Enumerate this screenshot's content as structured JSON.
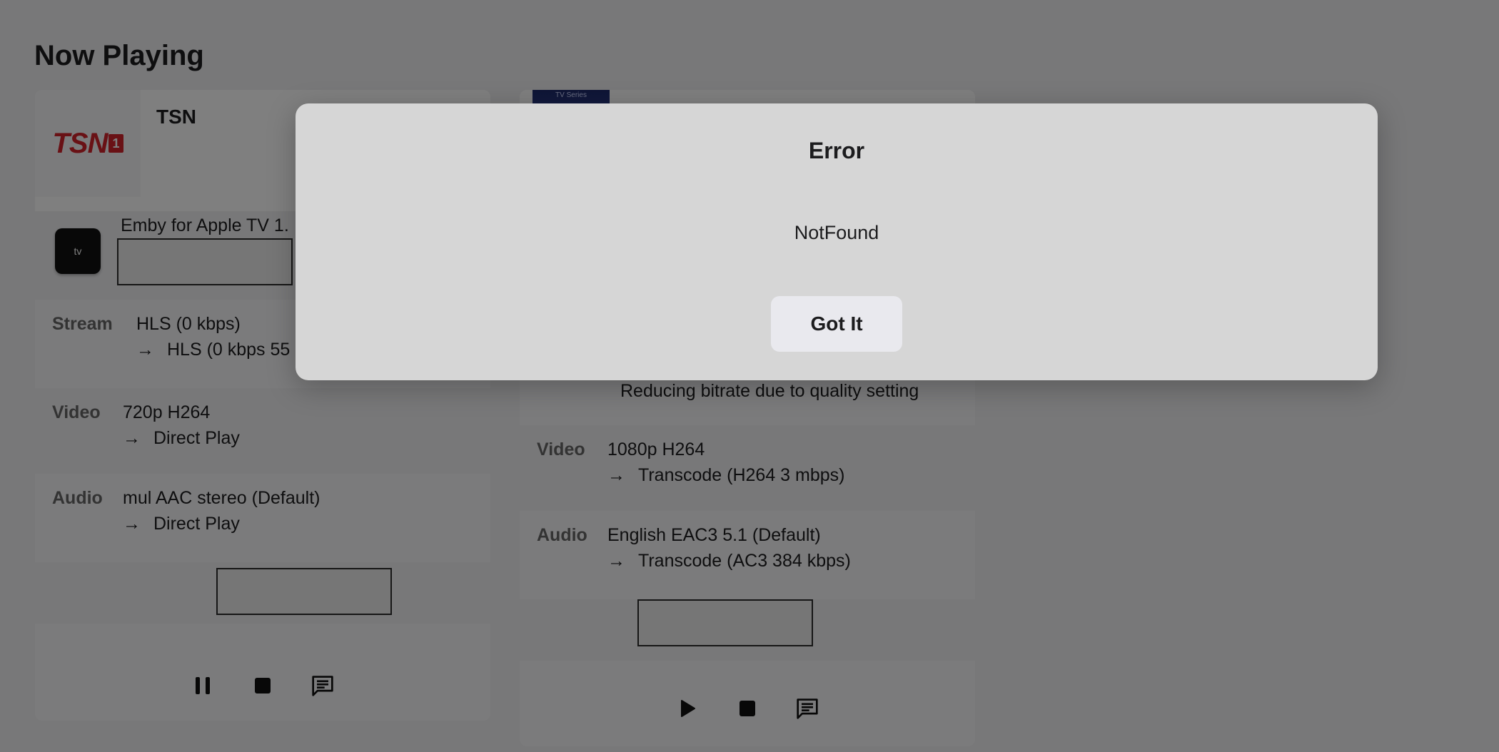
{
  "page": {
    "title": "Now Playing"
  },
  "sessions": [
    {
      "title": "TSN",
      "thumb_text": "TSN",
      "thumb_badge": "1",
      "device_icon_text": "tv",
      "device_name": "Emby for Apple TV 1.",
      "stream": {
        "label": "Stream",
        "value": "HLS (0 kbps)",
        "sub": "HLS (0 kbps 55"
      },
      "video": {
        "label": "Video",
        "value": "720p H264",
        "sub": "Direct Play"
      },
      "audio": {
        "label": "Audio",
        "value": "mul AAC stereo (Default)",
        "sub": "Direct Play"
      },
      "controls": [
        "pause-icon",
        "stop-icon",
        "subtitles-icon"
      ]
    },
    {
      "poster_text": "TV Series",
      "stream_note": "Reducing bitrate due to quality setting",
      "video": {
        "label": "Video",
        "value": "1080p H264",
        "sub": "Transcode (H264 3 mbps)"
      },
      "audio": {
        "label": "Audio",
        "value": "English EAC3 5.1 (Default)",
        "sub": "Transcode (AC3 384 kbps)"
      },
      "controls": [
        "play-icon",
        "stop-icon",
        "subtitles-icon"
      ]
    }
  ],
  "arrow": "→",
  "dialog": {
    "title": "Error",
    "message": "NotFound",
    "button_label": "Got It"
  },
  "colors": {
    "brand_red": "#d2232a",
    "overlay": "rgba(0,0,0,0.5)"
  }
}
